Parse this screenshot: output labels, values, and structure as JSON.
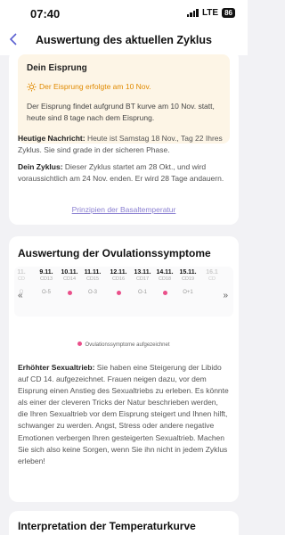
{
  "status": {
    "time": "07:40",
    "network": "LTE",
    "battery": "86"
  },
  "nav": {
    "title": "Auswertung des aktuellen Zyklus",
    "back_icon": "chevron-left-icon"
  },
  "ovulation": {
    "title": "Dein Eisprung",
    "badge": "Der Eisprung erfolgte am 10 Nov.",
    "badge_icon": "sun-icon",
    "description": "Der Eisprung findet aufgrund BT kurve am 10 Nov. statt, heute sind 8 tage nach dem Eisprung."
  },
  "news": {
    "label": "Heutige Nachricht:",
    "text": " Heute ist Samstag 18 Nov., Tag 22 Ihres Zyklus. Sie sind grade in der sicheren Phase."
  },
  "cycle": {
    "label": "Dein Zyklus:",
    "text": " Dieser Zyklus startet am 28 Okt., und wird voraussichtlich am 24 Nov. enden. Er wird 28 Tage andauern."
  },
  "link": {
    "label": "Prinzipien der Basaltemperatur"
  },
  "symptoms": {
    "title": "Auswertung der Ovulationssymptome",
    "prev_label": "«",
    "next_label": "»",
    "days": [
      {
        "date": "11.",
        "cd": "CD",
        "mark": "O",
        "dot": false,
        "faded": true
      },
      {
        "date": "9.11.",
        "cd": "CD13",
        "mark": "O-5",
        "dot": false,
        "faded": false
      },
      {
        "date": "10.11.",
        "cd": "CD14",
        "mark": "O-4",
        "dot": true,
        "faded": false
      },
      {
        "date": "11.11.",
        "cd": "CD15",
        "mark": "O-3",
        "dot": false,
        "faded": false
      },
      {
        "date": "12.11.",
        "cd": "CD16",
        "mark": "O-2",
        "dot": true,
        "faded": false
      },
      {
        "date": "13.11.",
        "cd": "CD17",
        "mark": "O-1",
        "dot": false,
        "faded": false
      },
      {
        "date": "14.11.",
        "cd": "CD18",
        "mark": "O",
        "dot": true,
        "faded": false
      },
      {
        "date": "15.11.",
        "cd": "CD19",
        "mark": "O+1",
        "dot": false,
        "faded": false
      },
      {
        "date": "16.1",
        "cd": "CD",
        "mark": "",
        "dot": false,
        "faded": true
      }
    ],
    "legend": "Ovulationssymptome aufgezeichnet",
    "dot_color": "#ea4f8a",
    "body_label": "Erhöhter Sexualtrieb:",
    "body_text": " Sie haben eine Steigerung der Libido auf CD 14. aufgezeichnet. Frauen neigen dazu, vor dem Eisprung einen Anstieg des Sexualtriebs zu erleben. Es könnte als einer der cleveren Tricks der Natur beschrieben werden, die Ihren Sexualtrieb vor dem Eisprung steigert und Ihnen hilft, schwanger zu werden. Angst, Stress oder andere negative Emotionen verbergen Ihren gesteigerten Sexualtrieb. Machen Sie sich also keine Sorgen, wenn Sie ihn nicht in jedem Zyklus erleben!"
  },
  "temperature": {
    "title": "Interpretation der Temperaturkurve"
  },
  "colors": {
    "accent_orange": "#e08a00",
    "badge_bg": "#fdf5e6",
    "link": "#8a7fd1"
  }
}
